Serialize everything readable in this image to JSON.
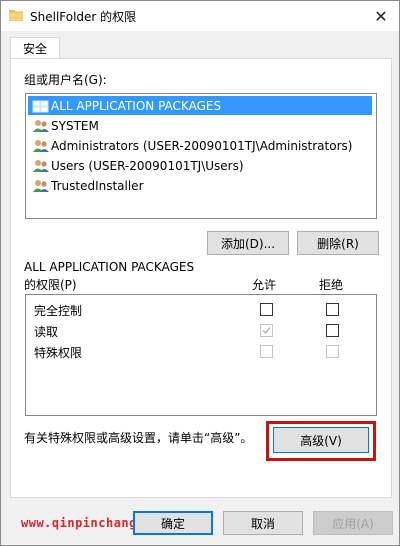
{
  "window": {
    "title": "ShellFolder 的权限",
    "close_glyph": "✕"
  },
  "tabs": [
    {
      "label": "安全"
    }
  ],
  "group": {
    "label": "组或用户名(G):",
    "items": [
      {
        "label": "ALL APPLICATION PACKAGES",
        "selected": true,
        "icon": "app-packages-icon"
      },
      {
        "label": "SYSTEM",
        "selected": false,
        "icon": "users-icon"
      },
      {
        "label": "Administrators (USER-20090101TJ\\Administrators)",
        "selected": false,
        "icon": "users-icon"
      },
      {
        "label": "Users (USER-20090101TJ\\Users)",
        "selected": false,
        "icon": "users-icon"
      },
      {
        "label": "TrustedInstaller",
        "selected": false,
        "icon": "users-icon"
      }
    ],
    "add_button": "添加(D)...",
    "remove_button": "删除(R)"
  },
  "permissions": {
    "owner_label": "ALL APPLICATION PACKAGES",
    "label": "的权限(P)",
    "allow_header": "允许",
    "deny_header": "拒绝",
    "rows": [
      {
        "name": "完全控制",
        "allow": false,
        "allow_disabled": false,
        "deny": false,
        "deny_disabled": false
      },
      {
        "name": "读取",
        "allow": true,
        "allow_disabled": true,
        "deny": false,
        "deny_disabled": false
      },
      {
        "name": "特殊权限",
        "allow": false,
        "allow_disabled": true,
        "deny": false,
        "deny_disabled": true
      }
    ]
  },
  "advanced": {
    "hint": "有关特殊权限或高级设置，请单击“高级”。",
    "button": "高级(V)",
    "highlight_color": "#cc1111"
  },
  "footer": {
    "watermark": "www.qinpinchang.com",
    "ok": "确定",
    "cancel": "取消",
    "apply": "应用(A)"
  },
  "colors": {
    "selection": "#3399ff",
    "watermark": "#d8262a"
  }
}
